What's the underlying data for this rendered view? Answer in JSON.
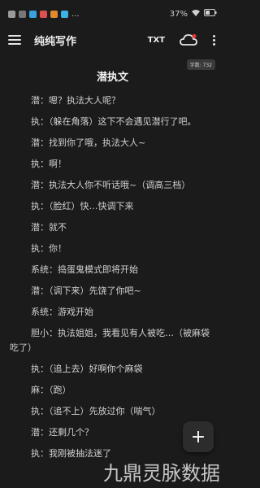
{
  "status": {
    "time": "",
    "dots": "...",
    "battery": "37%"
  },
  "app_bar": {
    "title": "纯纯写作",
    "txt_button": "TXT"
  },
  "word_count": "字数: 732",
  "doc_title": "潜执文",
  "paragraphs": [
    "潜：嗯？执法大人呢？",
    "执：（躲在角落）这下不会遇见潜行了吧。",
    "潜：找到你了哦，执法大人~",
    "执：啊！",
    "潜：执法大人你不听话哦~（调高三档）",
    "执：（脸红）快…快调下来",
    "潜：就不",
    "执：你！",
    "系统：捣蛋鬼模式即将开始",
    "潜：（调下来）先饶了你吧~",
    "系统：游戏开始",
    "胆小：执法姐姐，我看见有人被吃…（被麻袋吃了）",
    "执：（追上去）好啊你个麻袋",
    "麻：（跑）",
    "执：（追不上）先放过你（喘气）",
    "潜：还剩几个？",
    "执：我刚被抽法迷了"
  ],
  "fab_label": "+",
  "watermark": "九鼎灵脉数据",
  "colors": {
    "background": "#1b1b1b",
    "text": "#d2d2d2",
    "accent": "#ffffff"
  }
}
